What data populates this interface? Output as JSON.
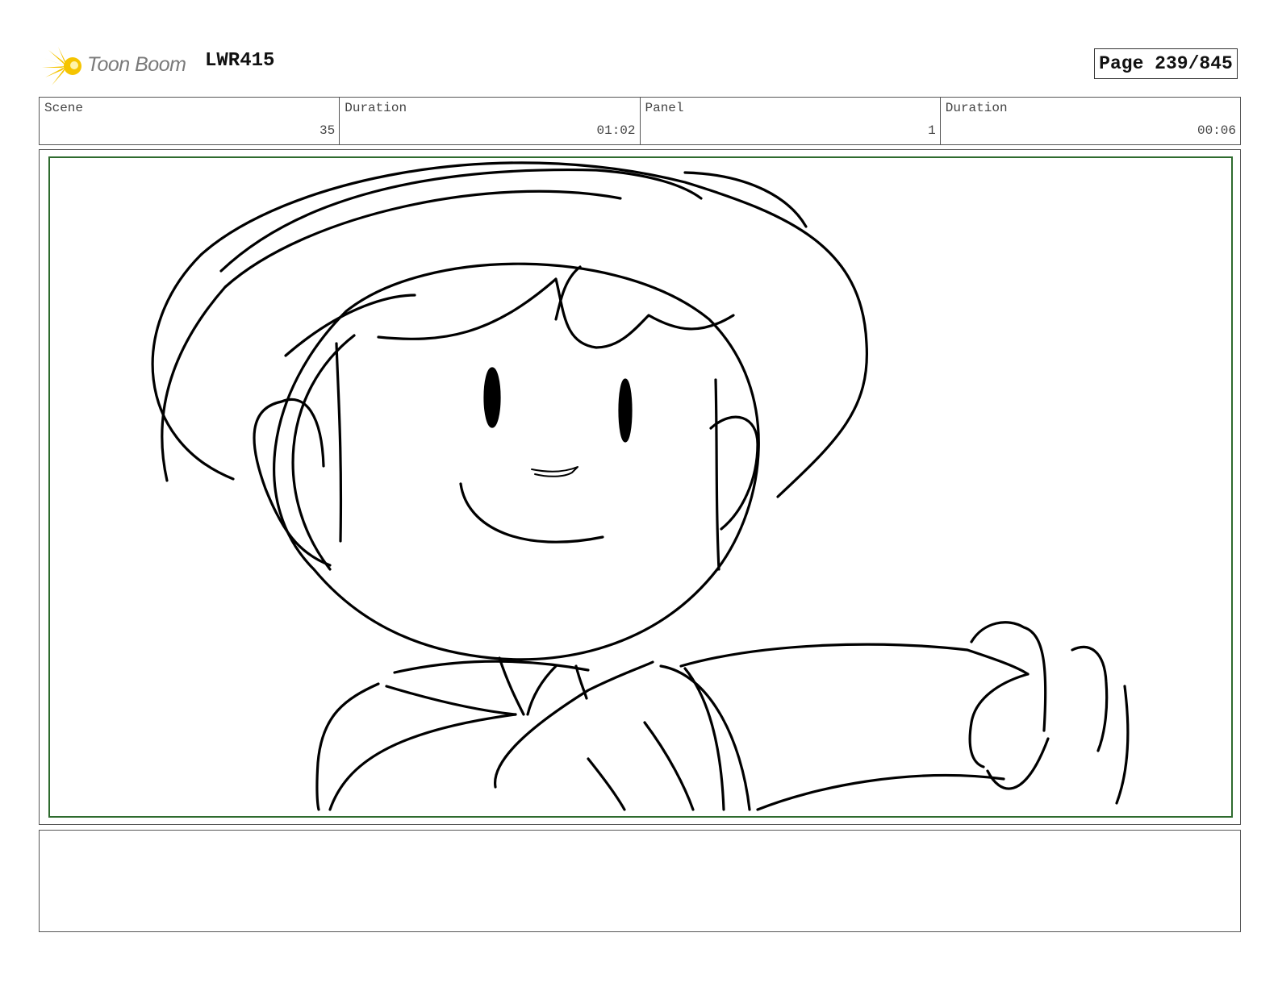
{
  "header": {
    "logo_text": "Toon Boom",
    "project_code": "LWR415",
    "page_label": "Page 239/845"
  },
  "info": {
    "scene_label": "Scene",
    "scene_value": "35",
    "scene_duration_label": "Duration",
    "scene_duration_value": "01:02",
    "panel_label": "Panel",
    "panel_value": "1",
    "panel_duration_label": "Duration",
    "panel_duration_value": "00:06"
  },
  "notes": {
    "text": ""
  },
  "colors": {
    "safe_area": "#2e6b2e",
    "logo_yellow": "#f5c400",
    "logo_text": "#7a7a7a"
  },
  "icons": {
    "logo": "toon-boom-burst-icon"
  }
}
